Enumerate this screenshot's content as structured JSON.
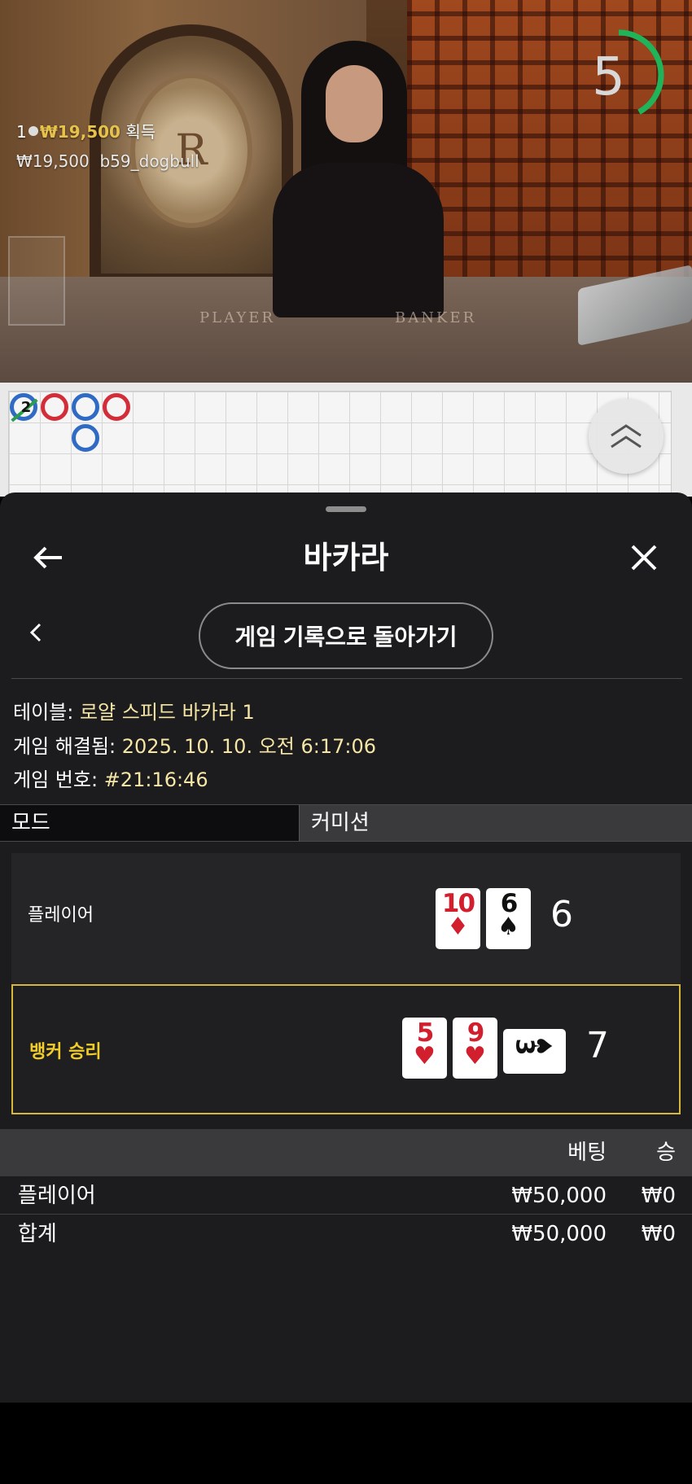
{
  "live": {
    "win_count": "1",
    "win_amount": "₩19,500",
    "win_suffix": "획득",
    "bet_amount": "₩19,500",
    "username": "b59_dogbull",
    "timer_value": "5",
    "timer_progress": 0.42,
    "timer_color": "#1fb45a",
    "table_player_label": "PLAYER",
    "table_banker_label": "BANKER",
    "emblem_letter": "R"
  },
  "roadmap": {
    "beads": [
      {
        "col": 0,
        "row": 0,
        "result": "blue",
        "number": "2",
        "pair": "green-slash"
      },
      {
        "col": 1,
        "row": 0,
        "result": "red"
      },
      {
        "col": 2,
        "row": 0,
        "result": "blue"
      },
      {
        "col": 2,
        "row": 1,
        "result": "blue"
      },
      {
        "col": 3,
        "row": 0,
        "result": "red"
      }
    ],
    "scroll_icon": "double-chevron-up-icon"
  },
  "modal": {
    "title": "바카라",
    "back_icon": "arrow-left-icon",
    "close_icon": "close-icon",
    "prev_icon": "chevron-left-icon",
    "history_button": "게임 기록으로 돌아가기",
    "table_label": "테이블:",
    "table_value": "로얄 스피드 바카라 1",
    "resolved_label": "게임 해결됨:",
    "resolved_value": "2025. 10. 10. 오전 6:17:06",
    "game_no_label": "게임 번호:",
    "game_no_value": "#21:16:46",
    "tabs": {
      "mode": "모드",
      "commission": "커미션"
    },
    "player_hand": {
      "label": "플레이어",
      "cards": [
        {
          "rank": "10",
          "suit": "♦",
          "color": "red"
        },
        {
          "rank": "6",
          "suit": "♠",
          "color": "black"
        }
      ],
      "score": "6"
    },
    "banker_hand": {
      "label": "뱅커 승리",
      "cards": [
        {
          "rank": "5",
          "suit": "♥",
          "color": "red"
        },
        {
          "rank": "9",
          "suit": "♥",
          "color": "red"
        },
        {
          "rank": "3",
          "suit": "♠",
          "color": "black",
          "sideways": true
        }
      ],
      "score": "7"
    },
    "bets": {
      "header": {
        "bet": "베팅",
        "win": "승"
      },
      "rows": [
        {
          "label": "플레이어",
          "bet": "₩50,000",
          "win": "₩0"
        },
        {
          "label": "합계",
          "bet": "₩50,000",
          "win": "₩0"
        }
      ]
    }
  }
}
